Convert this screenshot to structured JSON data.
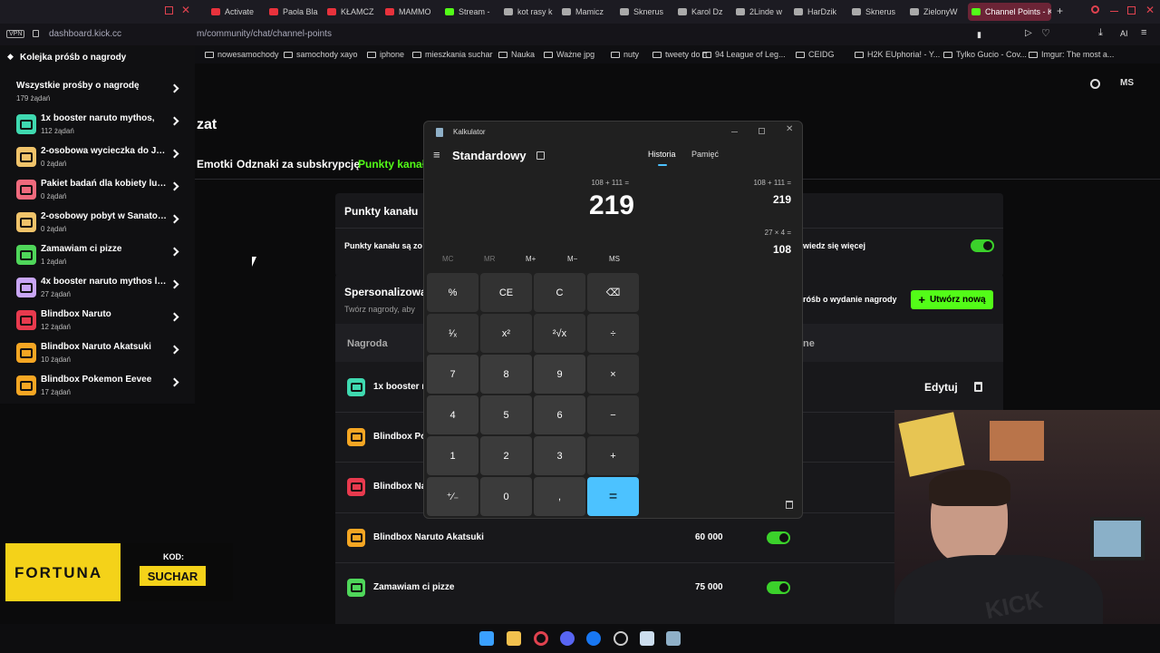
{
  "tabs": [
    "Activate",
    "Paola Bla",
    "KŁAMCZ",
    "MAMMO",
    "Stream -",
    "kot rasy k",
    "Mamicz",
    "Sknerus",
    "Karol Dz",
    "2Linde w",
    "HarDzik",
    "Sknerus",
    "ZielonyW",
    "Channel Points - K"
  ],
  "address": {
    "vpn": "VPN",
    "host": "dashboard.kick.cc",
    "path": "m/community/chat/channel-points"
  },
  "bookmarks": [
    "nowesamochody",
    "samochody xayo",
    "iphone",
    "mieszkania suchar",
    "Nauka",
    "Ważne jpg",
    "nuty",
    "tweety do rt",
    "94 League of Leg...",
    "CEIDG",
    "H2K EUphoria! - Y...",
    "Tylko Gucio - Cov...",
    "Imgur: The most a..."
  ],
  "sidebar": {
    "title": "Kolejka próśb o nagrody",
    "items": [
      {
        "title": "Wszystkie prośby o nagrodę",
        "count": "179 żądań",
        "color": ""
      },
      {
        "title": "1x booster naruto mythos,",
        "count": "112 żądań",
        "color": "#3fd9b0"
      },
      {
        "title": "2-osobowa wycieczka do Ja...",
        "count": "0 żądań",
        "color": "#f0c36a"
      },
      {
        "title": "Pakiet badań dla kobiety lub ...",
        "count": "0 żądań",
        "color": "#f06a7d"
      },
      {
        "title": "2-osobowy pobyt w Sanator...",
        "count": "0 żądań",
        "color": "#f0c36a"
      },
      {
        "title": "Zamawiam ci pizze",
        "count": "1 żądań",
        "color": "#4fd65a"
      },
      {
        "title": "4x booster naruto mythos liv...",
        "count": "27 żądań",
        "color": "#c9a6f5"
      },
      {
        "title": "Blindbox Naruto",
        "count": "12 żądań",
        "color": "#e83a4e"
      },
      {
        "title": "Blindbox Naruto Akatsuki",
        "count": "10 żądań",
        "color": "#f5a623"
      },
      {
        "title": "Blindbox Pokemon Eevee",
        "count": "17 żądań",
        "color": "#f5a623"
      }
    ]
  },
  "page": {
    "heading_fragment": "zat",
    "tabs": [
      "Emotki",
      "Odznaki za subskrypcję",
      "Punkty kanału"
    ],
    "section1_title": "Punkty kanału",
    "section1_text": "Punkty kanału są zo",
    "section1_link": "wiedz się więcej",
    "section2_title": "Spersonalizowa",
    "section2_sub": "Twórz nagrody, aby",
    "requests_label": "róśb o wydanie nagrody",
    "create_button": "Utwórz nową",
    "col_reward": "Nagroda",
    "col_status": "ne",
    "edit_label": "Edytuj",
    "rows": [
      {
        "name": "1x booster na",
        "cost": "",
        "color": "#3fd9b0"
      },
      {
        "name": "Blindbox Pol",
        "cost": "",
        "color": "#f5a623"
      },
      {
        "name": "Blindbox Nar",
        "cost": "",
        "color": "#e83a4e"
      },
      {
        "name": "Blindbox Naruto Akatsuki",
        "cost": "60 000",
        "color": "#f5a623"
      },
      {
        "name": "Zamawiam ci pizze",
        "cost": "75 000",
        "color": "#4fd65a"
      }
    ]
  },
  "calculator": {
    "window_title": "Kalkulator",
    "mode": "Standardowy",
    "tab_history": "Historia",
    "tab_memory": "Pamięć",
    "expression": "108 + 111 =",
    "display": "219",
    "memory_keys": [
      "MC",
      "MR",
      "M+",
      "M−",
      "MS"
    ],
    "keys": [
      "%",
      "CE",
      "C",
      "⌫",
      "¹⁄ₓ",
      "x²",
      "²√x",
      "÷",
      "7",
      "8",
      "9",
      "×",
      "4",
      "5",
      "6",
      "−",
      "1",
      "2",
      "3",
      "+",
      "⁺∕₋",
      "0",
      ",",
      "="
    ],
    "history": [
      {
        "expr": "108  +  111 =",
        "result": "219"
      },
      {
        "expr": "27  ×  4 =",
        "result": "108"
      }
    ]
  },
  "ad": {
    "brand": "FORTUNA",
    "code_label": "KOD:",
    "code": "SUCHAR"
  },
  "avatar_initials": "MS",
  "colors": {
    "kick_green": "#53fc18",
    "accent_blue": "#4cc2ff"
  }
}
